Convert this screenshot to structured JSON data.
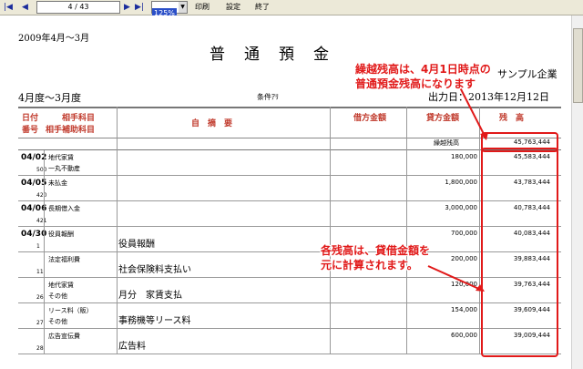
{
  "toolbar": {
    "first": "|◀",
    "prev": "◀",
    "page_indicator": "4 / 43",
    "next": "▶",
    "last": "▶|",
    "zoom": "125%",
    "print": "印刷",
    "settings": "設定",
    "close": "終了"
  },
  "report": {
    "period": "2009年4月～3月",
    "title": "普　通　預　金",
    "company": "サンプル企業",
    "range": "4月度～3月度",
    "condition": "条件ｱﾘ",
    "output_label": "出力日：2013年12月12日"
  },
  "headers": {
    "date": "日付",
    "number": "番号",
    "counter_account": "相手科目",
    "counter_sub": "相手補助科目",
    "description": "自　摘　要",
    "debit": "借方金額",
    "credit": "貸方金額",
    "balance": "残　高"
  },
  "carryover": {
    "label": "繰越残高",
    "amount": "45,763,444"
  },
  "rows": [
    {
      "date": "04/02",
      "num": "500",
      "acct1": "地代家賃",
      "acct2": "一丸不動産",
      "desc": "",
      "debit": "",
      "credit": "180,000",
      "balance": "45,583,444"
    },
    {
      "date": "04/05",
      "num": "420",
      "acct1": "未払金",
      "acct2": "",
      "desc": "",
      "debit": "",
      "credit": "1,800,000",
      "balance": "43,783,444"
    },
    {
      "date": "04/06",
      "num": "421",
      "acct1": "長期借入金",
      "acct2": "",
      "desc": "",
      "debit": "",
      "credit": "3,000,000",
      "balance": "40,783,444"
    },
    {
      "date": "04/30",
      "num": "1",
      "acct1": "役員報酬",
      "acct2": "",
      "desc": "役員報酬",
      "debit": "",
      "credit": "700,000",
      "balance": "40,083,444"
    },
    {
      "date": "",
      "num": "11",
      "acct1": "法定福利費",
      "acct2": "",
      "desc": "社会保険料支払い",
      "debit": "",
      "credit": "200,000",
      "balance": "39,883,444"
    },
    {
      "date": "",
      "num": "26",
      "acct1": "地代家賃",
      "acct2": "その他",
      "desc": "月分　家賃支払",
      "debit": "",
      "credit": "120,000",
      "balance": "39,763,444"
    },
    {
      "date": "",
      "num": "27",
      "acct1": "リース料（販）",
      "acct2": "その他",
      "desc": "事務機等リース料",
      "debit": "",
      "credit": "154,000",
      "balance": "39,609,444"
    },
    {
      "date": "",
      "num": "28",
      "acct1": "広告宣伝費",
      "acct2": "",
      "desc": "広告料",
      "debit": "",
      "credit": "600,000",
      "balance": "39,009,444"
    }
  ],
  "callouts": {
    "carryover_line1": "繰越残高は、4月1日時点の",
    "carryover_line2": "普通預金残高になります",
    "balance_line1": "各残高は、貸借金額を",
    "balance_line2": "元に計算されます。"
  },
  "colors": {
    "accent_red": "#e11919",
    "header_text": "#c0392b"
  }
}
